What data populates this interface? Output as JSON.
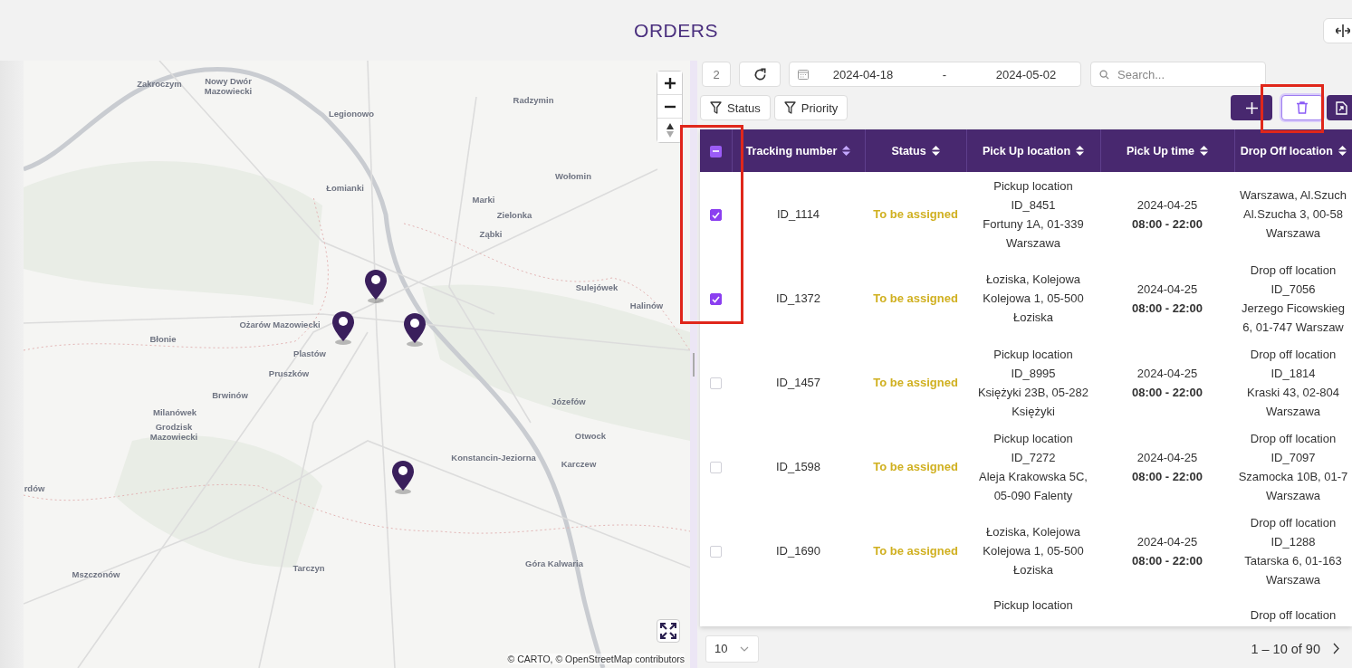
{
  "page": {
    "title": "ORDERS"
  },
  "map": {
    "labels": [
      "Zakroczym",
      "Nowy Dwór Mazowiecki",
      "Legionowo",
      "Radzymin",
      "Łomianki",
      "Wołomin",
      "Marki",
      "Zielonka",
      "Ząbki",
      "Sulejówek",
      "Halinów",
      "Ożarów Mazowiecki",
      "Błonie",
      "Plastów",
      "Pruszków",
      "Brwinów",
      "Milanówek",
      "Grodzisk Mazowiecki",
      "Józefów",
      "Otwock",
      "Konstancin-Jeziorna",
      "Karczew",
      "rdów",
      "Mszczonów",
      "Tarczyn",
      "Góra Kalwaria"
    ],
    "attribution": "© CARTO, © OpenStreetMap contributors"
  },
  "toolbar": {
    "selected_count": "2",
    "date_from": "2024-04-18",
    "date_separator": "-",
    "date_to": "2024-05-02",
    "search": {
      "placeholder": "Search..."
    },
    "filters": [
      "Status",
      "Priority"
    ],
    "delete_highlighted": true
  },
  "table": {
    "select_all_indeterminate": true,
    "checkbox_column_highlighted": true,
    "columns": [
      {
        "label": "Tracking number",
        "sorted": true
      },
      {
        "label": "Status",
        "sorted": false
      },
      {
        "label": "Pick Up location",
        "sorted": false
      },
      {
        "label": "Pick Up time",
        "sorted": false
      },
      {
        "label": "Drop Off location",
        "sorted": false
      }
    ],
    "rows": [
      {
        "checked": true,
        "tracking": "ID_1114",
        "status": "To be assigned",
        "pickup": [
          "Pickup location",
          "ID_8451",
          "Fortuny 1A, 01-339",
          "Warszawa"
        ],
        "date": "2024-04-25",
        "hours": "08:00 - 22:00",
        "dropoff": [
          "Warszawa, Al.Szuch",
          "Al.Szucha 3, 00-58",
          "Warszawa"
        ]
      },
      {
        "checked": true,
        "tracking": "ID_1372",
        "status": "To be assigned",
        "pickup": [
          "Łoziska, Kolejowa",
          "Kolejowa 1, 05-500",
          "Łoziska"
        ],
        "date": "2024-04-25",
        "hours": "08:00 - 22:00",
        "dropoff": [
          "Drop off location",
          "ID_7056",
          "Jerzego Ficowskieg",
          "6, 01-747 Warszaw"
        ]
      },
      {
        "checked": false,
        "tracking": "ID_1457",
        "status": "To be assigned",
        "pickup": [
          "Pickup location",
          "ID_8995",
          "Księżyki 23B, 05-282",
          "Księżyki"
        ],
        "date": "2024-04-25",
        "hours": "08:00 - 22:00",
        "dropoff": [
          "Drop off location",
          "ID_1814",
          "Kraski 43, 02-804",
          "Warszawa"
        ]
      },
      {
        "checked": false,
        "tracking": "ID_1598",
        "status": "To be assigned",
        "pickup": [
          "Pickup location",
          "ID_7272",
          "Aleja Krakowska 5C,",
          "05-090 Falenty"
        ],
        "date": "2024-04-25",
        "hours": "08:00 - 22:00",
        "dropoff": [
          "Drop off location",
          "ID_7097",
          "Szamocka 10B, 01-7",
          "Warszawa"
        ]
      },
      {
        "checked": false,
        "tracking": "ID_1690",
        "status": "To be assigned",
        "pickup": [
          "Łoziska, Kolejowa",
          "Kolejowa 1, 05-500",
          "Łoziska"
        ],
        "date": "2024-04-25",
        "hours": "08:00 - 22:00",
        "dropoff": [
          "Drop off location",
          "ID_1288",
          "Tatarska 6, 01-163",
          "Warszawa"
        ]
      }
    ],
    "cut_row": {
      "pickup": [
        "Pickup location"
      ],
      "dropoff": [
        "Drop off location"
      ]
    }
  },
  "pager": {
    "page_size": "10",
    "range": "1 – 10 of 90"
  }
}
